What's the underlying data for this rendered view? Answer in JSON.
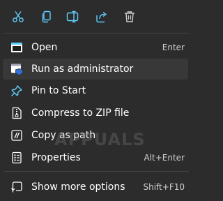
{
  "toolbar": {
    "icons": [
      "cut-icon",
      "copy-icon",
      "rename-icon",
      "share-icon",
      "delete-icon"
    ]
  },
  "menu": {
    "items": [
      {
        "label": "Open",
        "shortcut": "Enter",
        "icon": "open-icon"
      },
      {
        "label": "Run as administrator",
        "shortcut": "",
        "icon": "shield-icon"
      },
      {
        "label": "Pin to Start",
        "shortcut": "",
        "icon": "pin-icon"
      },
      {
        "label": "Compress to ZIP file",
        "shortcut": "",
        "icon": "zip-icon"
      },
      {
        "label": "Copy as path",
        "shortcut": "",
        "icon": "copy-path-icon"
      },
      {
        "label": "Properties",
        "shortcut": "Alt+Enter",
        "icon": "properties-icon"
      },
      {
        "label": "Show more options",
        "shortcut": "Shift+F10",
        "icon": "more-options-icon"
      }
    ]
  },
  "watermark": "APPUALS",
  "colors": {
    "background": "#2c2c2c",
    "hover": "#383838",
    "accent": "#60cdff",
    "separator": "#454545"
  }
}
